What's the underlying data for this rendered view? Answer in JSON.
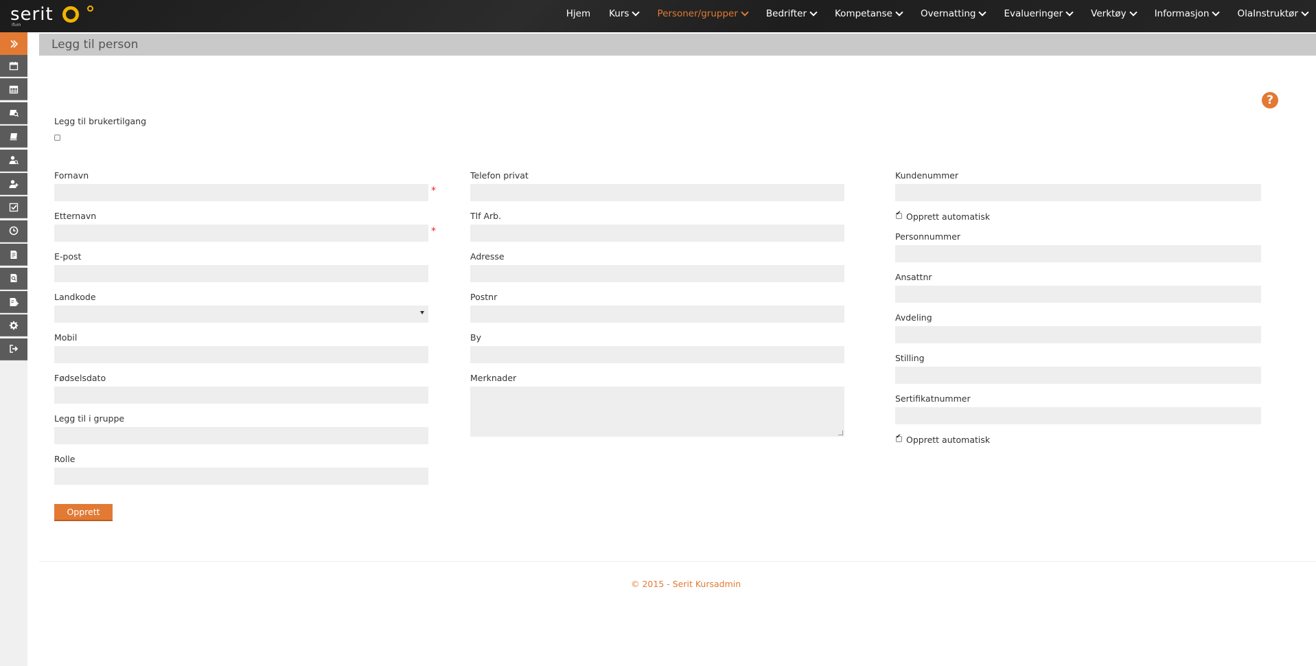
{
  "brand": {
    "logo_text": "serit",
    "logo_sub": "ifum",
    "accent_color": "#e27a34",
    "logo_color": "#f0b400"
  },
  "nav": {
    "items": [
      {
        "label": "Hjem",
        "dropdown": false,
        "active": false
      },
      {
        "label": "Kurs",
        "dropdown": true,
        "active": false
      },
      {
        "label": "Personer/grupper",
        "dropdown": true,
        "active": true
      },
      {
        "label": "Bedrifter",
        "dropdown": true,
        "active": false
      },
      {
        "label": "Kompetanse",
        "dropdown": true,
        "active": false
      },
      {
        "label": "Overnatting",
        "dropdown": true,
        "active": false
      },
      {
        "label": "Evalueringer",
        "dropdown": true,
        "active": false
      },
      {
        "label": "Verktøy",
        "dropdown": true,
        "active": false
      },
      {
        "label": "Informasjon",
        "dropdown": true,
        "active": false
      },
      {
        "label": "OlaInstruktør",
        "dropdown": true,
        "active": false
      }
    ]
  },
  "sidebar": {
    "icons": [
      "double-chevron-right-icon",
      "calendar-icon",
      "calendar-grid-icon",
      "course-search-icon",
      "course-list-icon",
      "user-search-icon",
      "user-add-icon",
      "checklist-icon",
      "clock-icon",
      "document-icon",
      "document-search-icon",
      "document-add-icon",
      "gear-icon",
      "logout-icon"
    ]
  },
  "page": {
    "title": "Legg til person",
    "help_symbol": "?"
  },
  "form": {
    "user_access_label": "Legg til brukertilgang",
    "user_access_checked": false,
    "col1": {
      "fornavn": "Fornavn",
      "etternavn": "Etternavn",
      "epost": "E-post",
      "landkode": "Landkode",
      "mobil": "Mobil",
      "fodselsdato": "Fødselsdato",
      "gruppe": "Legg til i gruppe",
      "rolle": "Rolle",
      "required_mark": "*"
    },
    "col2": {
      "tlf_privat": "Telefon privat",
      "tlf_arb": "Tlf Arb.",
      "adresse": "Adresse",
      "postnr": "Postnr",
      "by": "By",
      "merknader": "Merknader"
    },
    "col3": {
      "kundenummer": "Kundenummer",
      "opprett_auto_1": "Opprett automatisk",
      "opprett_auto_1_checked": true,
      "personnummer": "Personnummer",
      "ansattnr": "Ansattnr",
      "avdeling": "Avdeling",
      "stilling": "Stilling",
      "sertifikatnummer": "Sertifikatnummer",
      "opprett_auto_2": "Opprett automatisk",
      "opprett_auto_2_checked": true
    },
    "submit_label": "Opprett"
  },
  "footer": {
    "text": "© 2015 - Serit Kursadmin"
  }
}
